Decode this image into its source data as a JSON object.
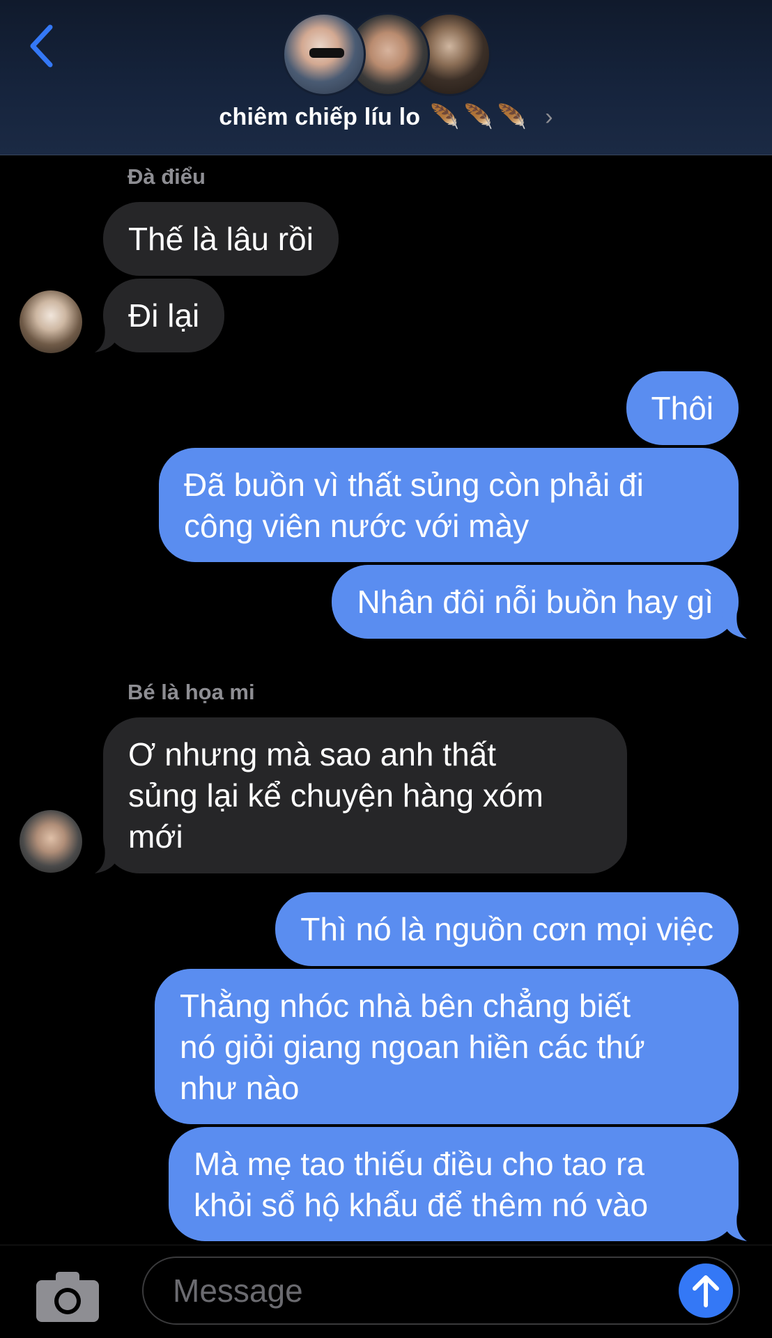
{
  "header": {
    "title": "chiêm chiếp líu lo",
    "title_emoji": "🪶🪶🪶",
    "chevron": "›",
    "back_icon": "chevron-left-icon"
  },
  "messages": [
    {
      "type": "sender",
      "text": "Đà điểu"
    },
    {
      "type": "in",
      "text": "Thế là lâu rồi"
    },
    {
      "type": "in",
      "text": "Đi lại"
    },
    {
      "type": "out",
      "text": "Thôi"
    },
    {
      "type": "out",
      "text": "Đã buồn vì thất sủng còn phải đi\ncông viên nước với mày"
    },
    {
      "type": "out",
      "text": "Nhân đôi nỗi buồn hay gì"
    },
    {
      "type": "sender",
      "text": "Bé là họa mi"
    },
    {
      "type": "in",
      "text": "Ơ nhưng mà sao anh thất\nsủng lại kể chuyện hàng xóm\nmới"
    },
    {
      "type": "out",
      "text": "Thì nó là nguồn cơn mọi việc"
    },
    {
      "type": "out",
      "text": "Thằng nhóc nhà bên chẳng biết\nnó giỏi giang ngoan hiền các thứ\nnhư nào"
    },
    {
      "type": "out",
      "text": "Mà mẹ tao thiếu điều cho tao ra\nkhỏi sổ hộ khẩu để thêm nó vào"
    }
  ],
  "composer": {
    "placeholder": "Message",
    "camera_icon": "camera-icon",
    "send_icon": "arrow-up-icon"
  },
  "colors": {
    "outgoing_bubble": "#5a8df0",
    "incoming_bubble": "#262628",
    "accent": "#3478f6"
  }
}
